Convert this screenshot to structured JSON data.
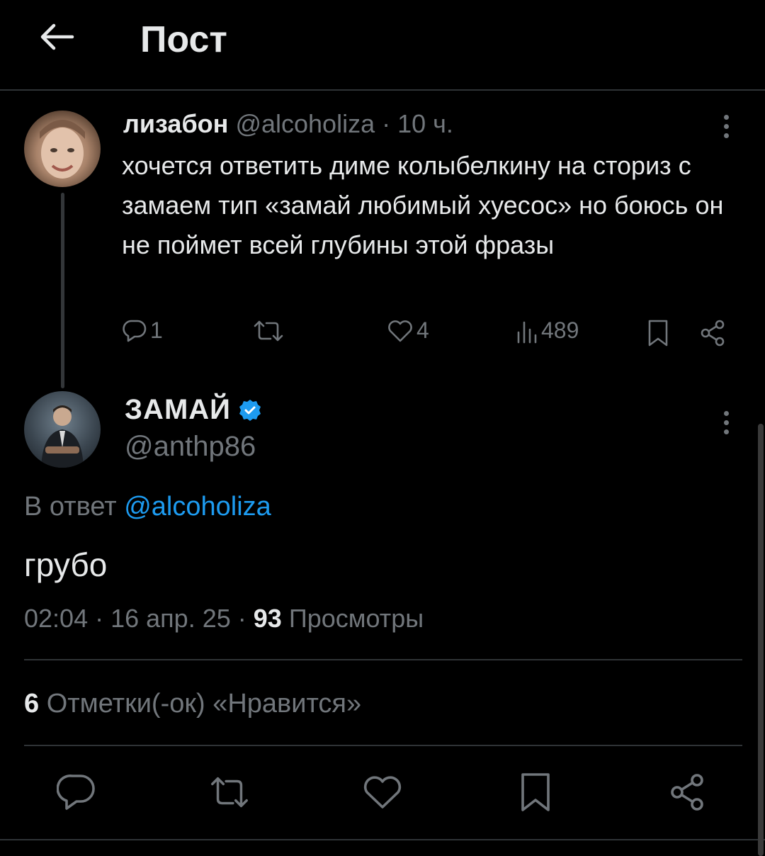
{
  "header": {
    "title": "Пост"
  },
  "parent_tweet": {
    "display_name": "лизабон",
    "handle": "@alcoholiza",
    "separator": "·",
    "time": "10 ч.",
    "text": "хочется ответить диме колыбелкину на сториз с замаем тип «замай любимый хуесос» но боюсь он не поймет всей глубины этой фразы",
    "replies": "1",
    "likes": "4",
    "views": "489"
  },
  "main_tweet": {
    "display_name": "ЗАМАЙ",
    "handle": "@anthp86",
    "reply_prefix": "В ответ",
    "reply_handle": "@alcoholiza",
    "text": "грубо",
    "time": "02:04",
    "date": "16 апр. 25",
    "views_count": "93",
    "views_label": "Просмотры",
    "likes_count": "6",
    "likes_label": "Отметки(-ок) «Нравится»"
  },
  "colors": {
    "background": "#000000",
    "text": "#e7e9ea",
    "muted": "#71767b",
    "accent": "#1d9bf0",
    "divider": "#2f3336"
  }
}
